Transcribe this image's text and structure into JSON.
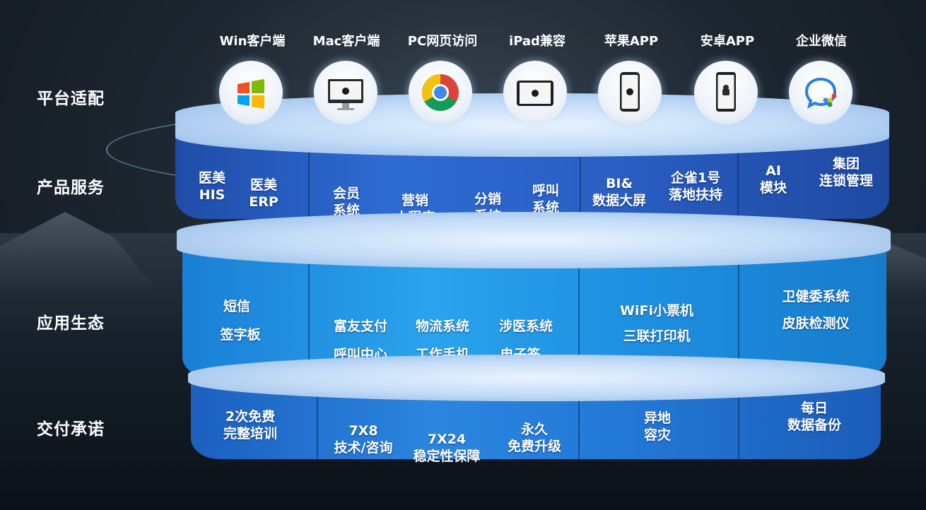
{
  "row_labels": {
    "platform": "平台适配",
    "product": "产品服务",
    "ecosystem": "应用生态",
    "delivery": "交付承诺"
  },
  "platforms": [
    {
      "label": "Win客户端",
      "icon": "windows-icon"
    },
    {
      "label": "Mac客户端",
      "icon": "imac-icon"
    },
    {
      "label": "PC网页访问",
      "icon": "chrome-icon"
    },
    {
      "label": "iPad兼容",
      "icon": "ipad-icon"
    },
    {
      "label": "苹果APP",
      "icon": "iphone-icon"
    },
    {
      "label": "安卓APP",
      "icon": "android-phone-icon"
    },
    {
      "label": "企业微信",
      "icon": "wecom-icon"
    }
  ],
  "product_services": [
    {
      "line1": "医美",
      "line2": "HIS"
    },
    {
      "line1": "医美",
      "line2": "ERP"
    },
    {
      "line1": "会员",
      "line2": "系统"
    },
    {
      "line1": "营销",
      "line2": "小程序"
    },
    {
      "line1": "分销",
      "line2": "系统"
    },
    {
      "line1": "呼叫",
      "line2": "系统"
    },
    {
      "line1": "BI&",
      "line2": "数据大屏"
    },
    {
      "line1": "企雀1号",
      "line2": "落地扶持"
    },
    {
      "line1": "AI",
      "line2": "模块"
    },
    {
      "line1": "集团",
      "line2": "连锁管理"
    }
  ],
  "ecosystem": {
    "col1": [
      "短信",
      "签字板"
    ],
    "col2": [
      "富友支付",
      "呼叫中心"
    ],
    "col3": [
      "物流系统",
      "工作手机"
    ],
    "col4": [
      "涉医系统",
      "电子签"
    ],
    "col5": [
      "WiFi小票机",
      "三联打印机"
    ],
    "col6": [
      "卫健委系统",
      "皮肤检测仪"
    ]
  },
  "delivery": [
    {
      "line1": "2次免费",
      "line2": "完整培训"
    },
    {
      "line1": "7X8",
      "line2": "技术/咨询"
    },
    {
      "line1": "7X24",
      "line2": "稳定性保障"
    },
    {
      "line1": "永久",
      "line2": "免费升级"
    },
    {
      "line1": "异地",
      "line2": "容灾"
    },
    {
      "line1": "每日",
      "line2": "数据备份"
    }
  ],
  "colors": {
    "chrome_red": "#db4437",
    "chrome_yellow": "#f4c20d",
    "chrome_green": "#0f9d58",
    "chrome_blue": "#4285f4",
    "wecom_blue": "#2b7de0"
  }
}
